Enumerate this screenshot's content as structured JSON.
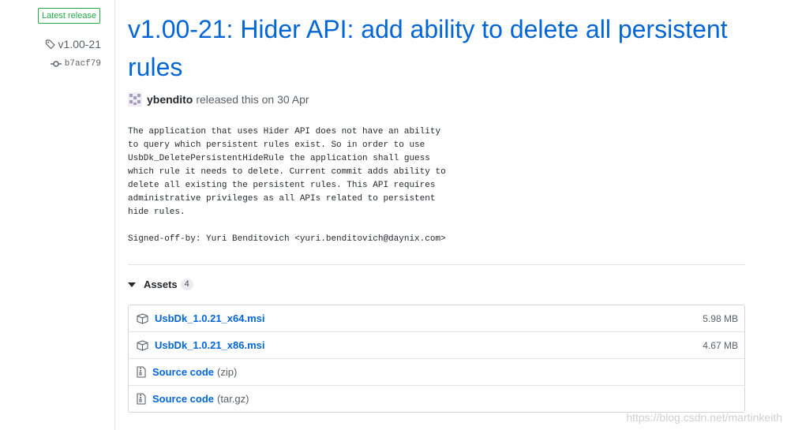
{
  "sidebar": {
    "badge": "Latest release",
    "tag": "v1.00-21",
    "commit": "b7acf79"
  },
  "release": {
    "title": "v1.00-21: Hider API: add ability to delete all persistent rules",
    "author": "ybendito",
    "released_text": "released this on 30 Apr",
    "body": "The application that uses Hider API does not have an ability\nto query which persistent rules exist. So in order to use\nUsbDk_DeletePersistentHideRule the application shall guess\nwhich rule it needs to delete. Current commit adds ability to\ndelete all existing the persistent rules. This API requires\nadministrative privileges as all APIs related to persistent\nhide rules.\n\nSigned-off-by: Yuri Benditovich <yuri.benditovich@daynix.com>"
  },
  "assets": {
    "label": "Assets",
    "count": "4",
    "items": [
      {
        "name": "UsbDk_1.0.21_x64.msi",
        "size": "5.98 MB",
        "icon": "package-icon"
      },
      {
        "name": "UsbDk_1.0.21_x86.msi",
        "size": "4.67 MB",
        "icon": "package-icon"
      },
      {
        "name": "Source code",
        "suffix": "(zip)",
        "icon": "file-zip-icon"
      },
      {
        "name": "Source code",
        "suffix": "(tar.gz)",
        "icon": "file-zip-icon"
      }
    ]
  },
  "watermark": "https://blog.csdn.net/martinkeith",
  "colors": {
    "link": "#0366d6",
    "badge_green": "#28a745",
    "muted": "#586069"
  }
}
